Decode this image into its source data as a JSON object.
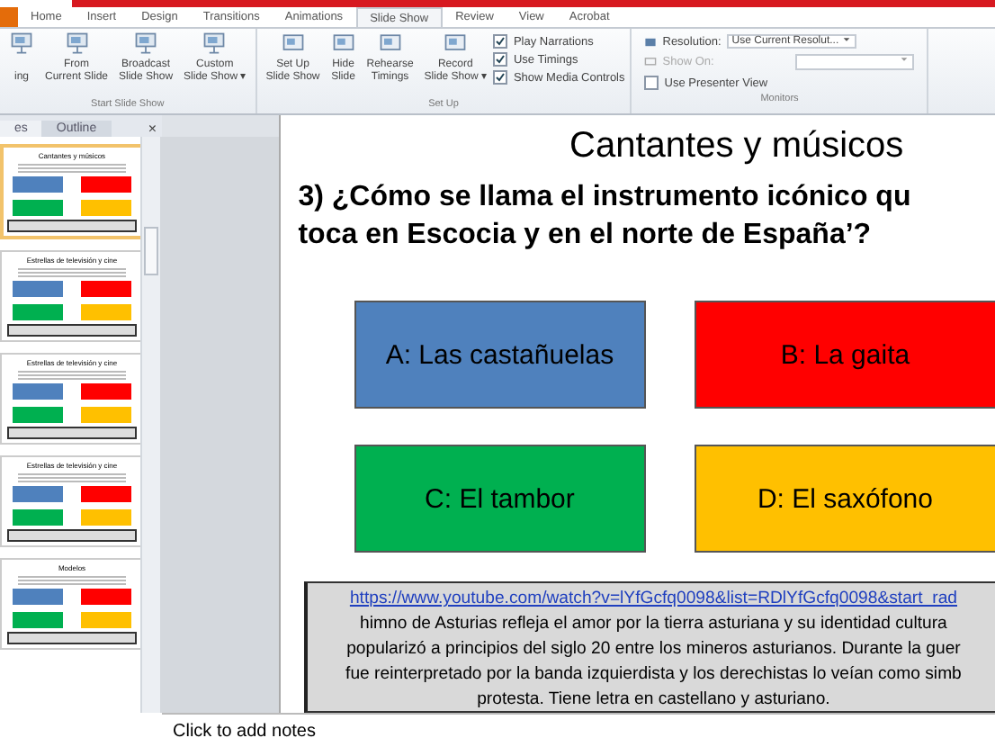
{
  "ribbon": {
    "tabs": [
      {
        "label": "Home",
        "selected": false
      },
      {
        "label": "Insert",
        "selected": false
      },
      {
        "label": "Design",
        "selected": false
      },
      {
        "label": "Transitions",
        "selected": false
      },
      {
        "label": "Animations",
        "selected": false
      },
      {
        "label": "Slide Show",
        "selected": true
      },
      {
        "label": "Review",
        "selected": false
      },
      {
        "label": "View",
        "selected": false
      },
      {
        "label": "Acrobat",
        "selected": false
      }
    ],
    "groups": [
      {
        "label": "Start Slide Show",
        "buttons": [
          {
            "line2": "ing"
          },
          {
            "line1": "From",
            "line2": "Current Slide"
          },
          {
            "line1": "Broadcast",
            "line2": "Slide Show"
          },
          {
            "line1": "Custom",
            "line2": "Slide Show ▾"
          }
        ]
      },
      {
        "label": "Set Up",
        "buttons": [
          {
            "line1": "Set Up",
            "line2": "Slide Show"
          },
          {
            "line1": "Hide",
            "line2": "Slide"
          },
          {
            "line1": "Rehearse",
            "line2": "Timings"
          },
          {
            "line1": "Record",
            "line2": "Slide Show ▾"
          }
        ],
        "checks": [
          {
            "label": "Play Narrations",
            "checked": true
          },
          {
            "label": "Use Timings",
            "checked": true
          },
          {
            "label": "Show Media Controls",
            "checked": true
          }
        ]
      },
      {
        "label": "Monitors",
        "resolution_label": "Resolution:",
        "resolution_value": "Use Current Resolut...",
        "show_on_label": "Show On:",
        "presenter": {
          "label": "Use Presenter View",
          "checked": false
        }
      }
    ]
  },
  "panel": {
    "tabs": [
      {
        "label": "es",
        "selected": true
      },
      {
        "label": "Outline",
        "selected": false
      }
    ],
    "close": "×",
    "thumbnails": [
      {
        "title": "Cantantes y músicos",
        "selected": true
      },
      {
        "title": "Estrellas de televisión y cine",
        "selected": false
      },
      {
        "title": "Estrellas de televisión y cine",
        "selected": false
      },
      {
        "title": "Estrellas de televisión y cine",
        "selected": false
      },
      {
        "title": "Modelos",
        "selected": false
      }
    ]
  },
  "slide": {
    "title": "Cantantes y músicos",
    "question_line1": "3) ¿Cómo se llama el instrumento icónico qu",
    "question_line2": "toca en Escocia y en el norte de España’?",
    "answers": [
      {
        "label": "A: Las castañuelas",
        "color": "#4f81bd"
      },
      {
        "label": "B: La gaita",
        "color": "#ff0000"
      },
      {
        "label": "C: El tambor",
        "color": "#00b050"
      },
      {
        "label": "D: El saxófono",
        "color": "#ffc000"
      }
    ],
    "note_link": "https://www.youtube.com/watch?v=lYfGcfq0098&list=RDlYfGcfq0098&start_rad",
    "note_lines": [
      "himno de Asturias refleja el amor por la tierra asturiana y su identidad cultura",
      "popularizó a principios del siglo 20 entre los mineros asturianos. Durante la guer",
      "fue reinterpretado por la banda izquierdista y los derechistas lo veían como simb",
      "protesta. Tiene letra en castellano y asturiano."
    ]
  },
  "notes_placeholder": "Click to add notes"
}
